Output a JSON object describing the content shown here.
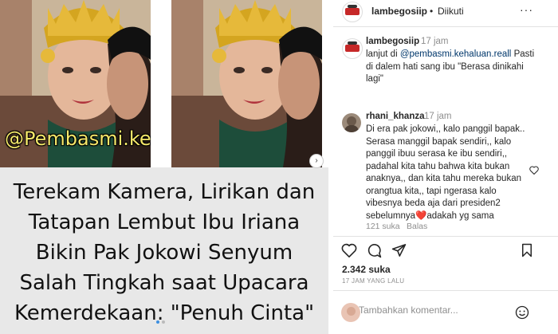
{
  "post": {
    "watermark": "@Pembasmi.kehaluan.reall",
    "headline_lines": [
      "Terekam Kamera, Lirikan dan",
      "Tatapan Lembut Ibu Iriana",
      "Bikin Pak Jokowi Senyum",
      "Salah Tingkah saat Upacara",
      "Kemerdekaan: \"Penuh Cinta\""
    ],
    "next_arrow": "›"
  },
  "header": {
    "username": "lambegosiip",
    "separator": "•",
    "follow_status": "Diikuti",
    "more_icon": "···"
  },
  "caption": {
    "username": "lambegosiip",
    "time": "17 jam",
    "prefix": "lanjut di ",
    "mention": "@pembasmi.kehaluan.reall",
    "text": " Pasti di dalem hati sang ibu \"Berasa dinikahi lagi\""
  },
  "comment": {
    "username": "rhani_khanza",
    "time": "17 jam",
    "text": "Di era pak jokowi,, kalo panggil bapak.. Serasa manggil bapak sendiri,, kalo panggil ibuu serasa ke ibu sendiri,, padahal kita tahu bahwa kita bukan anaknya,, dan kita tahu mereka bukan orangtua kita,, tapi ngerasa kalo vibesnya beda aja dari presiden2 sebelumnya",
    "heart_emoji": "❤️",
    "text_tail": "adakah yg sama",
    "likes": "121 suka",
    "reply": "Balas"
  },
  "actions": {
    "likes_count": "2.342 suka",
    "timestamp": "17 JAM YANG LALU"
  },
  "add_comment": {
    "placeholder": "Tambahkan komentar..."
  },
  "colors": {
    "link": "#00376b",
    "muted": "#8e8e8e",
    "headline_bg": "#e8e8e8",
    "watermark": "#f5e86a"
  }
}
